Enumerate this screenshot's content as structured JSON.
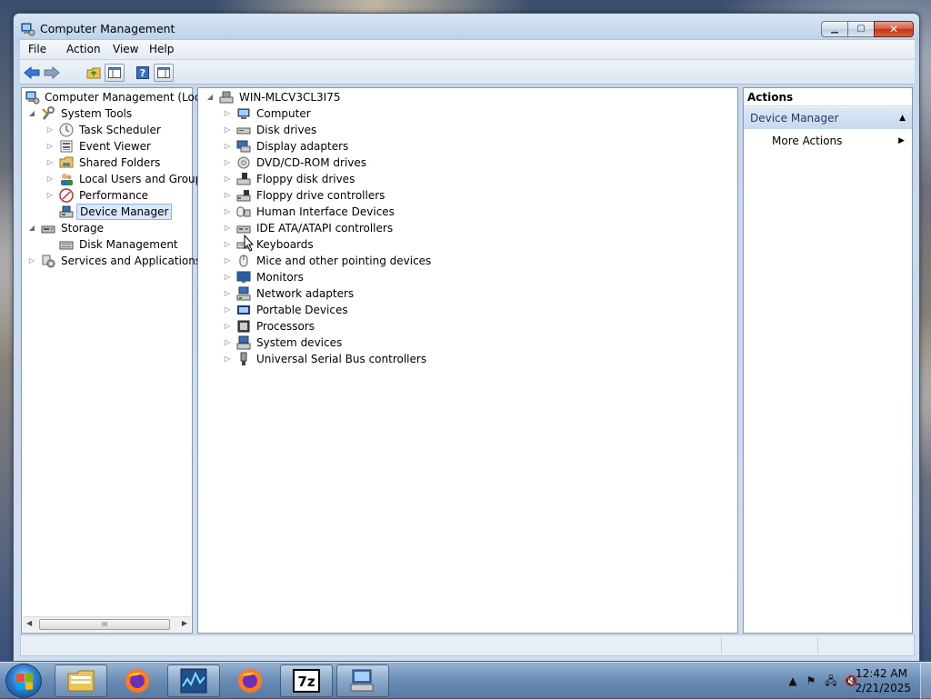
{
  "window": {
    "title": "Computer Management",
    "buttons": [
      "minimize",
      "maximize",
      "close"
    ]
  },
  "menu": [
    "File",
    "Action",
    "View",
    "Help"
  ],
  "toolbar": {
    "buttons": [
      "back-arrow-icon",
      "forward-arrow-icon",
      "up-folder-icon",
      "show-hide-console-tree-icon",
      "help-icon",
      "show-hide-action-pane-icon"
    ]
  },
  "tree": {
    "root": "Computer Management (Local",
    "system_tools": "System Tools",
    "task_scheduler": "Task Scheduler",
    "event_viewer": "Event Viewer",
    "shared_folders": "Shared Folders",
    "local_users": "Local Users and Groups",
    "performance": "Performance",
    "device_manager": "Device Manager",
    "storage": "Storage",
    "disk_management": "Disk Management",
    "services": "Services and Applications",
    "scroll_grip": "III"
  },
  "devices": {
    "host": "WIN-MLCV3CL3I75",
    "items": [
      "Computer",
      "Disk drives",
      "Display adapters",
      "DVD/CD-ROM drives",
      "Floppy disk drives",
      "Floppy drive controllers",
      "Human Interface Devices",
      "IDE ATA/ATAPI controllers",
      "Keyboards",
      "Mice and other pointing devices",
      "Monitors",
      "Network adapters",
      "Portable Devices",
      "Processors",
      "System devices",
      "Universal Serial Bus controllers"
    ]
  },
  "actions": {
    "header": "Actions",
    "group": "Device Manager",
    "more": "More Actions"
  },
  "taskbar": {
    "apps": [
      "Windows Explorer",
      "Firefox",
      "Resource Monitor",
      "Firefox",
      "7-Zip",
      "Computer Management"
    ],
    "time": "12:42 AM",
    "date": "2/21/2025"
  },
  "colors": {
    "selection": "#d9e8fb",
    "actions_group": "#c7d9ee",
    "window_frame": "#bcd2ea"
  }
}
